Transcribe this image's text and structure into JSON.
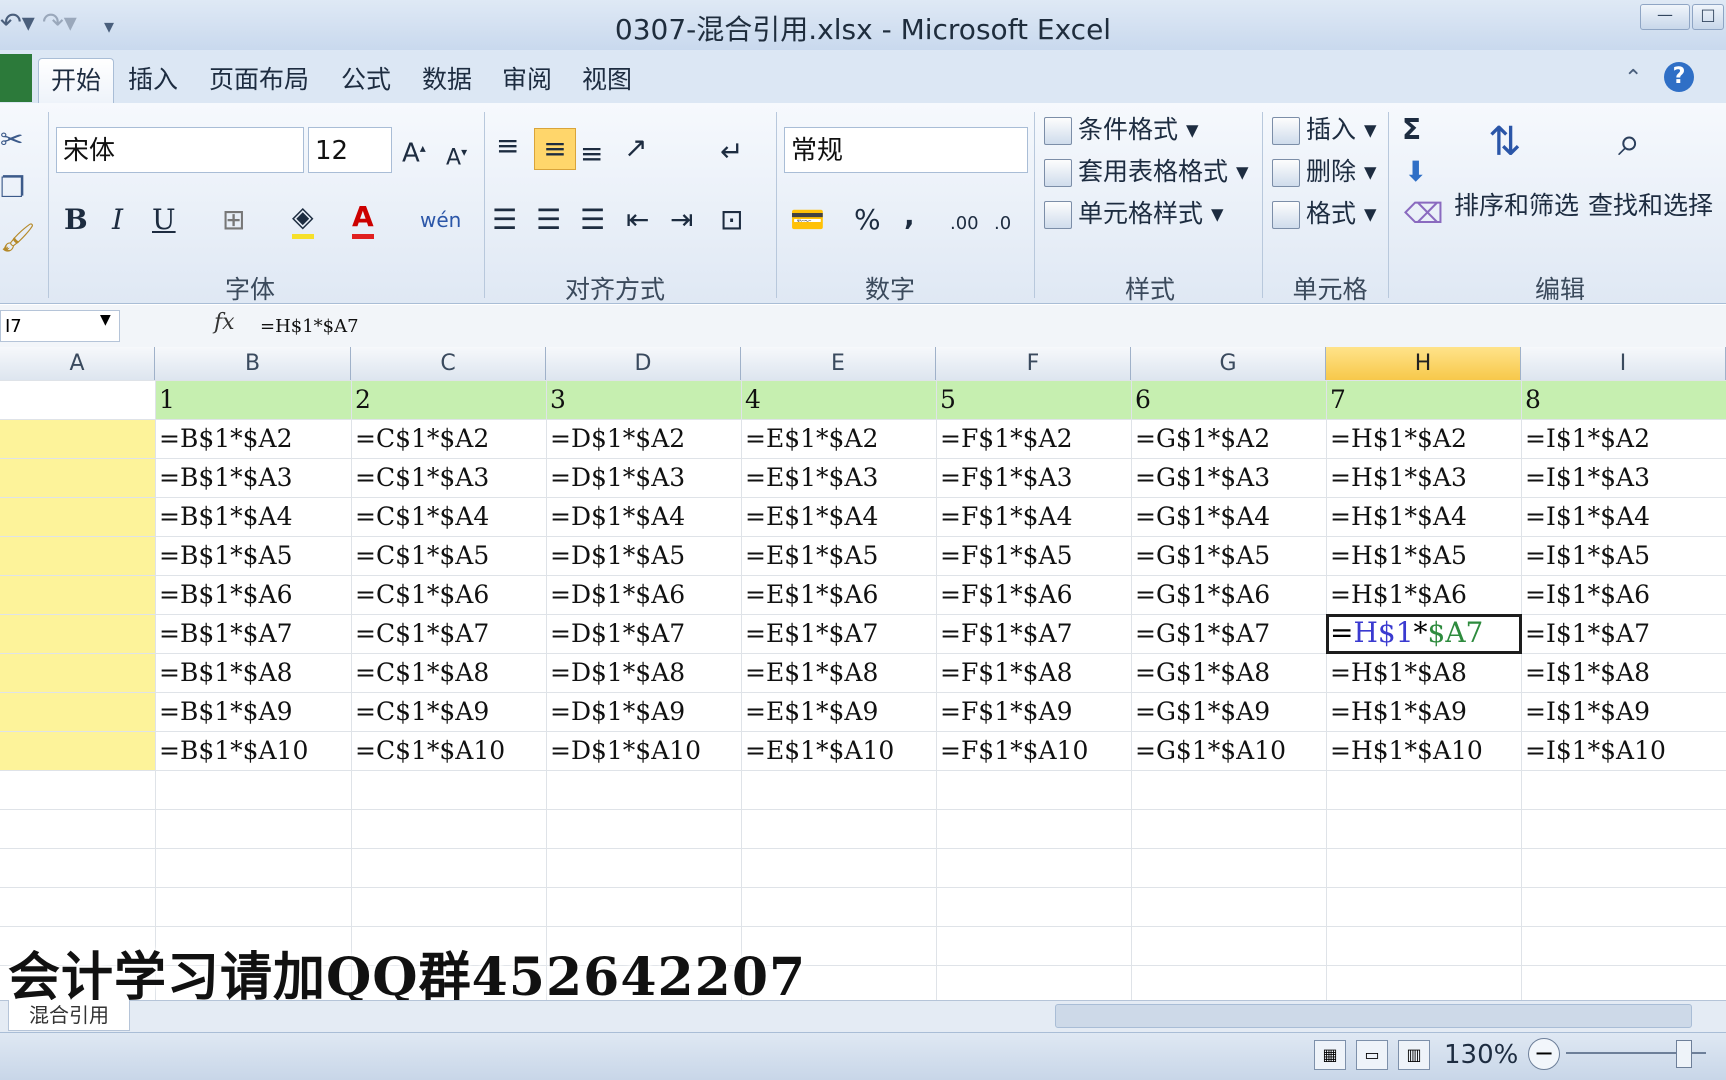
{
  "window": {
    "title": "0307-混合引用.xlsx - Microsoft Excel"
  },
  "quick_access": {
    "undo_icon": "undo-icon",
    "redo_icon": "redo-icon",
    "customize_icon": "customize-qat-icon"
  },
  "tabs": [
    {
      "label": "开始",
      "active": true
    },
    {
      "label": "插入"
    },
    {
      "label": "页面布局"
    },
    {
      "label": "公式"
    },
    {
      "label": "数据"
    },
    {
      "label": "审阅"
    },
    {
      "label": "视图"
    }
  ],
  "ribbon": {
    "font": {
      "name": "宋体",
      "size": "12",
      "bold": "B",
      "italic": "I",
      "underline": "U",
      "wen": "wén",
      "label": "字体"
    },
    "alignment": {
      "label": "对齐方式"
    },
    "number": {
      "format": "常规",
      "percent": "%",
      "comma": ",",
      "label": "数字"
    },
    "styles": {
      "conditional": "条件格式",
      "table_format": "套用表格格式",
      "cell_style": "单元格样式",
      "label": "样式"
    },
    "cells": {
      "insert": "插入",
      "delete": "删除",
      "format": "格式",
      "label": "单元格"
    },
    "editing": {
      "sum": "Σ",
      "sort": "排序和筛选",
      "find": "查找和选择",
      "label": "编辑"
    }
  },
  "formula_bar": {
    "name_box": "I7",
    "fx": "fx",
    "formula": "=H$1*$A7"
  },
  "columns": [
    "A",
    "B",
    "C",
    "D",
    "E",
    "F",
    "G",
    "H",
    "I"
  ],
  "selected_column": "H",
  "header_row": [
    "1",
    "2",
    "3",
    "4",
    "5",
    "6",
    "7",
    "8"
  ],
  "rows": [
    [
      "=B$1*$A2",
      "=C$1*$A2",
      "=D$1*$A2",
      "=E$1*$A2",
      "=F$1*$A2",
      "=G$1*$A2",
      "=H$1*$A2",
      "=I$1*$A2"
    ],
    [
      "=B$1*$A3",
      "=C$1*$A3",
      "=D$1*$A3",
      "=E$1*$A3",
      "=F$1*$A3",
      "=G$1*$A3",
      "=H$1*$A3",
      "=I$1*$A3"
    ],
    [
      "=B$1*$A4",
      "=C$1*$A4",
      "=D$1*$A4",
      "=E$1*$A4",
      "=F$1*$A4",
      "=G$1*$A4",
      "=H$1*$A4",
      "=I$1*$A4"
    ],
    [
      "=B$1*$A5",
      "=C$1*$A5",
      "=D$1*$A5",
      "=E$1*$A5",
      "=F$1*$A5",
      "=G$1*$A5",
      "=H$1*$A5",
      "=I$1*$A5"
    ],
    [
      "=B$1*$A6",
      "=C$1*$A6",
      "=D$1*$A6",
      "=E$1*$A6",
      "=F$1*$A6",
      "=G$1*$A6",
      "=H$1*$A6",
      "=I$1*$A6"
    ],
    [
      "=B$1*$A7",
      "=C$1*$A7",
      "=D$1*$A7",
      "=E$1*$A7",
      "=F$1*$A7",
      "=G$1*$A7",
      "",
      "=I$1*$A7"
    ],
    [
      "=B$1*$A8",
      "=C$1*$A8",
      "=D$1*$A8",
      "=E$1*$A8",
      "=F$1*$A8",
      "=G$1*$A8",
      "=H$1*$A8",
      "=I$1*$A8"
    ],
    [
      "=B$1*$A9",
      "=C$1*$A9",
      "=D$1*$A9",
      "=E$1*$A9",
      "=F$1*$A9",
      "=G$1*$A9",
      "=H$1*$A9",
      "=I$1*$A9"
    ],
    [
      "=B$1*$A10",
      "=C$1*$A10",
      "=D$1*$A10",
      "=E$1*$A10",
      "=F$1*$A10",
      "=G$1*$A10",
      "=H$1*$A10",
      "=I$1*$A10"
    ]
  ],
  "active_cell": {
    "part1": "=",
    "part2": "H$1",
    "part3": "*",
    "part4": "$A7"
  },
  "watermark": "会计学习请加QQ群452642207",
  "sheet_tab": "混合引用",
  "status": {
    "zoom": "130%"
  },
  "colors": {
    "header_row_fill": "#c6efb0",
    "column_a_fill": "#fdf39a",
    "selected_col": "#f7c84a",
    "ref_blue": "#3a3ad0",
    "ref_green": "#2e8b3e"
  }
}
